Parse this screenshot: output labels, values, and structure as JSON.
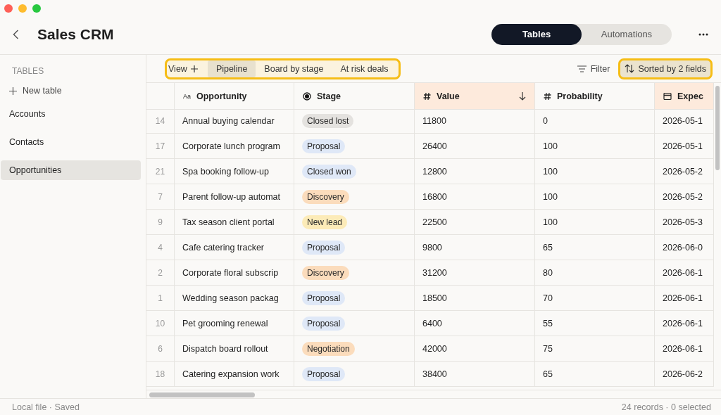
{
  "window": {
    "title": "Sales CRM"
  },
  "mode_tabs": [
    {
      "label": "Tables",
      "selected": true
    },
    {
      "label": "Automations",
      "selected": false
    }
  ],
  "sidebar": {
    "heading": "TABLES",
    "new_table": "New table",
    "items": [
      {
        "label": "Accounts",
        "selected": false
      },
      {
        "label": "Contacts",
        "selected": false
      },
      {
        "label": "Opportunities",
        "selected": true
      }
    ]
  },
  "toolbar": {
    "views_highlighted": true,
    "view_label": "View",
    "views": [
      {
        "label": "Pipeline",
        "selected": true
      },
      {
        "label": "Board by stage",
        "selected": false
      },
      {
        "label": "At risk deals",
        "selected": false
      }
    ],
    "filter": "Filter",
    "sort": {
      "label": "Sorted by 2 fields",
      "highlighted": true
    }
  },
  "table": {
    "columns": [
      {
        "label": "Opportunity",
        "kind": "text",
        "type_label": "Aa",
        "sorted": false
      },
      {
        "label": "Stage",
        "kind": "select",
        "sorted": false
      },
      {
        "label": "Value",
        "kind": "number",
        "sorted": true,
        "sort_descending": true
      },
      {
        "label": "Probability",
        "kind": "number",
        "sorted": false
      },
      {
        "label": "Expec",
        "kind": "date",
        "sorted": true
      }
    ],
    "rows": [
      {
        "num": "14",
        "opportunity": "Annual buying calendar",
        "stage": "Closed lost",
        "color": "#e4e2df",
        "value": "11800",
        "probability": "0",
        "date": "2026-05-1"
      },
      {
        "num": "17",
        "opportunity": "Corporate lunch program",
        "stage": "Proposal",
        "color": "#dfe8f7",
        "value": "26400",
        "probability": "100",
        "date": "2026-05-1"
      },
      {
        "num": "21",
        "opportunity": "Spa booking follow-up",
        "stage": "Closed won",
        "color": "#dfe8f7",
        "value": "12800",
        "probability": "100",
        "date": "2026-05-2"
      },
      {
        "num": "7",
        "opportunity": "Parent follow-up automat",
        "stage": "Discovery",
        "color": "#fbdcbc",
        "value": "16800",
        "probability": "100",
        "date": "2026-05-2"
      },
      {
        "num": "9",
        "opportunity": "Tax season client portal",
        "stage": "New lead",
        "color": "#fcebb8",
        "value": "22500",
        "probability": "100",
        "date": "2026-05-3"
      },
      {
        "num": "4",
        "opportunity": "Cafe catering tracker",
        "stage": "Proposal",
        "color": "#dfe8f7",
        "value": "9800",
        "probability": "65",
        "date": "2026-06-0"
      },
      {
        "num": "2",
        "opportunity": "Corporate floral subscrip",
        "stage": "Discovery",
        "color": "#fbdcbc",
        "value": "31200",
        "probability": "80",
        "date": "2026-06-1"
      },
      {
        "num": "1",
        "opportunity": "Wedding season packag",
        "stage": "Proposal",
        "color": "#dfe8f7",
        "value": "18500",
        "probability": "70",
        "date": "2026-06-1"
      },
      {
        "num": "10",
        "opportunity": "Pet grooming renewal",
        "stage": "Proposal",
        "color": "#dfe8f7",
        "value": "6400",
        "probability": "55",
        "date": "2026-06-1"
      },
      {
        "num": "6",
        "opportunity": "Dispatch board rollout",
        "stage": "Negotiation",
        "color": "#fbdcbc",
        "value": "42000",
        "probability": "75",
        "date": "2026-06-1"
      },
      {
        "num": "18",
        "opportunity": "Catering expansion work",
        "stage": "Proposal",
        "color": "#dfe8f7",
        "value": "38400",
        "probability": "65",
        "date": "2026-06-2"
      }
    ]
  },
  "status_bar": {
    "left": "Local file · Saved",
    "right": "24 records · 0 selected"
  }
}
